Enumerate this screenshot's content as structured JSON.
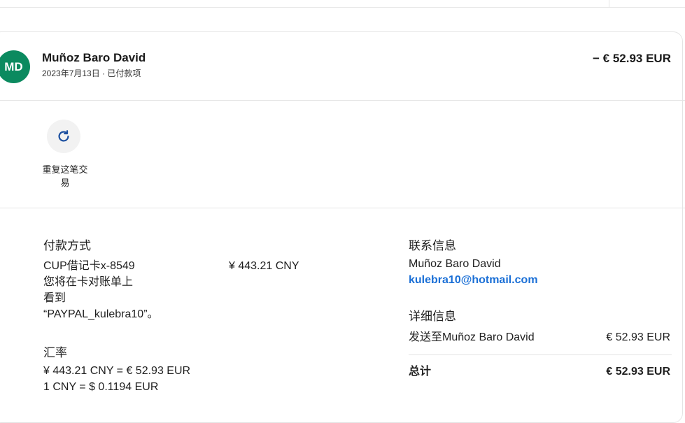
{
  "transaction": {
    "avatar_initials": "MD",
    "avatar_color": "#0b8a5f",
    "merchant_name": "Muñoz Baro David",
    "date_status": "2023年7月13日 · 已付款项",
    "amount": "− € 52.93 EUR"
  },
  "actions": {
    "repeat_icon": "refresh-icon",
    "repeat_label_line1": "重复这笔交",
    "repeat_label_line2": "易"
  },
  "payment": {
    "title": "付款方式",
    "card": "CUP借记卡x-8549",
    "card_amount": "¥ 443.21 CNY",
    "statement_note_1": "您将在卡对账单上",
    "statement_note_2": "看到",
    "statement_note_3": "“PAYPAL_kulebra10”。"
  },
  "exchange": {
    "title": "汇率",
    "line1": "¥ 443.21 CNY = € 52.93 EUR",
    "line2": "1 CNY = $ 0.1194 EUR"
  },
  "contact": {
    "title": "联系信息",
    "name": "Muñoz Baro David",
    "email": "kulebra10@hotmail.com"
  },
  "details": {
    "title": "详细信息",
    "sent_to_label": "发送至Muñoz Baro David",
    "sent_to_amount": "€ 52.93 EUR",
    "total_label": "总计",
    "total_amount": "€ 52.93 EUR"
  },
  "colors": {
    "link": "#1a6fd6",
    "avatar": "#0b8a5f"
  }
}
